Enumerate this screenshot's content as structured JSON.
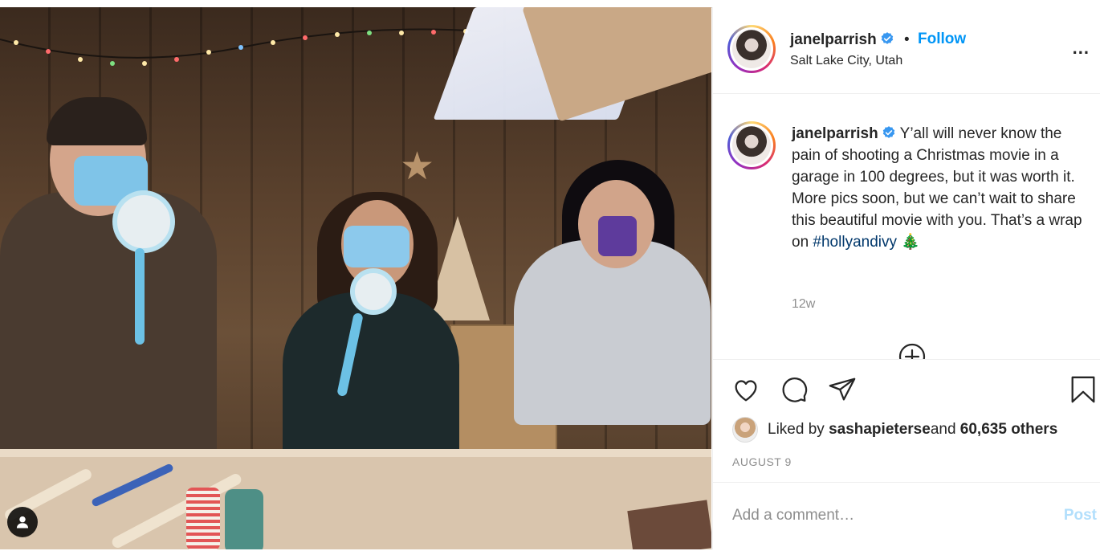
{
  "post": {
    "header": {
      "username": "janelparrish",
      "follow_label": "Follow",
      "separator": "•",
      "location": "Salt Lake City, Utah",
      "more_label": "..."
    },
    "caption": {
      "username": "janelparrish",
      "text": " Y’all will never know the pain of shooting a Christmas movie in a garage in 100 degrees, but it was worth it. More pics soon, but we can’t wait to share this beautiful movie with you. That’s a wrap on ",
      "hashtag": "#hollyandivy",
      "emoji": "🎄",
      "time_ago": "12w"
    },
    "likes": {
      "prefix": "Liked by ",
      "liked_by": "sashapieterse",
      "middle": " and ",
      "others": "60,635 others"
    },
    "date": "AUGUST 9",
    "comment": {
      "placeholder": "Add a comment…",
      "post_label": "Post"
    },
    "icons": {
      "like": "heart-icon",
      "comment": "comment-icon",
      "share": "share-icon",
      "save": "bookmark-icon",
      "verified": "verified-badge-icon",
      "load_more": "plus-circle-icon",
      "user_tag": "user-icon"
    },
    "colors": {
      "follow": "#0095f6",
      "verified": "#3897f0",
      "hashtag": "#00376b",
      "muted": "#8e8e8e",
      "post_disabled": "#b2dffc"
    }
  }
}
